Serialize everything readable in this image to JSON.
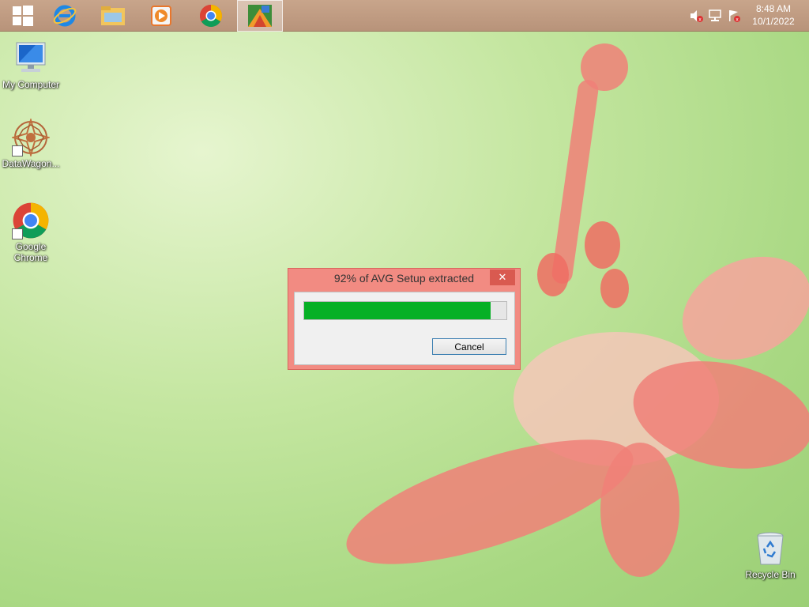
{
  "taskbar": {
    "pinned": [
      {
        "icon": "windows-start-icon"
      },
      {
        "icon": "internet-explorer-icon"
      },
      {
        "icon": "file-explorer-icon"
      },
      {
        "icon": "media-player-icon"
      },
      {
        "icon": "chrome-icon"
      },
      {
        "icon": "avg-setup-icon",
        "active": true
      }
    ],
    "tray": [
      "volume-muted-icon",
      "network-icon",
      "action-center-flag-icon"
    ],
    "clock": {
      "time": "8:48 AM",
      "date": "10/1/2022"
    }
  },
  "desktop": {
    "icons": [
      {
        "label": "My Computer",
        "icon": "computer-icon"
      },
      {
        "label": "DataWagon...",
        "icon": "datawagon-icon"
      },
      {
        "label": "Google Chrome",
        "icon": "chrome-icon"
      },
      {
        "label": "Recycle Bin",
        "icon": "recycle-bin-icon"
      }
    ]
  },
  "dialog": {
    "title": "92% of AVG Setup extracted",
    "close_glyph": "✕",
    "progress_percent": 92,
    "progress_color": "#06b025",
    "cancel_label": "Cancel"
  }
}
